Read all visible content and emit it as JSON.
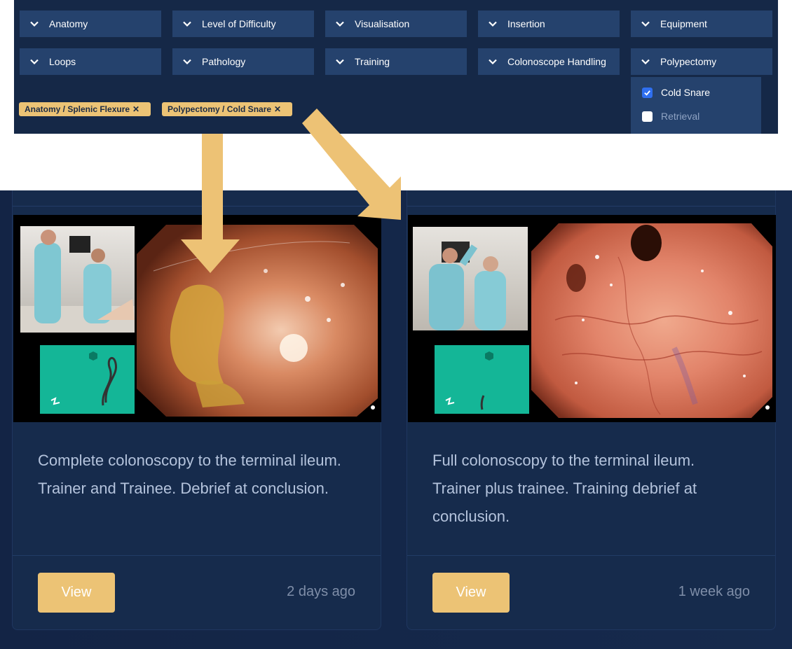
{
  "filters": {
    "row1": [
      "Anatomy",
      "Level of Difficulty",
      "Visualisation",
      "Insertion",
      "Equipment"
    ],
    "row2": [
      "Loops",
      "Pathology",
      "Training",
      "Colonoscope Handling",
      "Polypectomy"
    ]
  },
  "active_tags": [
    {
      "label": "Anatomy / Splenic Flexure",
      "remove_glyph": "✕"
    },
    {
      "label": "Polypectomy / Cold Snare",
      "remove_glyph": "✕"
    }
  ],
  "polypectomy_dropdown": {
    "options": [
      {
        "label": "Cold Snare",
        "checked": true
      },
      {
        "label": "Retrieval",
        "checked": false
      }
    ]
  },
  "cards": [
    {
      "description": "Complete colonoscopy to the terminal ileum. Trainer and Trainee. Debrief at conclusion.",
      "button_label": "View",
      "date": "2 days ago"
    },
    {
      "description": "Full colonoscopy to the terminal ileum. Trainer plus trainee. Training debrief at conclusion.",
      "button_label": "View",
      "date": "1 week ago"
    }
  ],
  "colors": {
    "panel_bg": "#152847",
    "filter_button": "#25426d",
    "accent_gold": "#ecc375",
    "checkbox_blue": "#2f6ff0",
    "card_bg": "#162b4c",
    "video_green_panel": "#14b697",
    "arrow": "#edc275"
  },
  "icons": {
    "filter_chevron": "chevron-down-icon",
    "tag_remove": "close-icon",
    "checkbox": "check-icon",
    "annotation": "arrow-icon"
  }
}
